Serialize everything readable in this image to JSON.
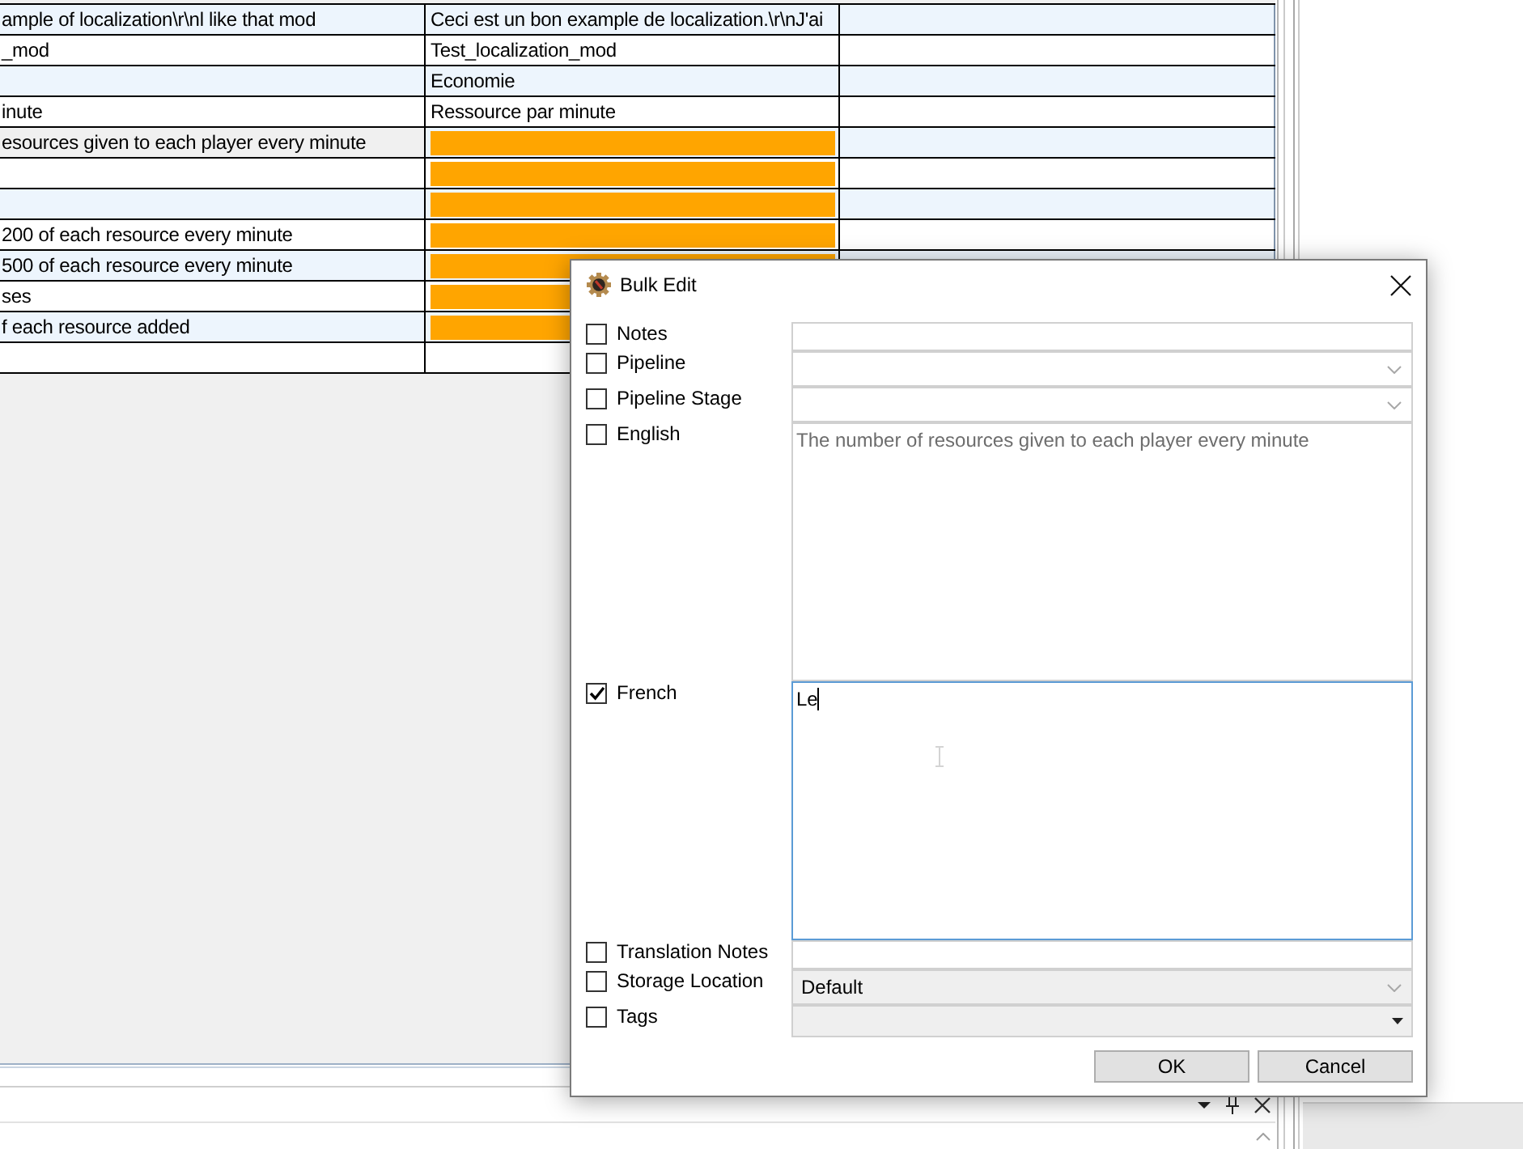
{
  "table": {
    "rows": [
      {
        "column_1": "ample of localization\\r\\nl like that mod",
        "column_2": "Ceci est un bon example de localization.\\r\\nJ'ai",
        "selected": false,
        "highlighted": false
      },
      {
        "column_1": "_mod",
        "column_2": "Test_localization_mod",
        "selected": false,
        "highlighted": false
      },
      {
        "column_2": "Economie",
        "selected": false,
        "highlighted": false
      },
      {
        "column_1": "inute",
        "column_2": "Ressource par minute",
        "selected": false,
        "highlighted": false
      },
      {
        "column_1": "esources given to each player every minute",
        "selected": true,
        "highlighted": true
      },
      {
        "selected": false,
        "highlighted": true
      },
      {
        "selected": false,
        "highlighted": true
      },
      {
        "column_1": "200 of each resource every minute",
        "selected": false,
        "highlighted": true
      },
      {
        "column_1": "500 of each resource every minute",
        "selected": false,
        "highlighted": true
      },
      {
        "column_1": "ses",
        "selected": false,
        "highlighted": true
      },
      {
        "column_1": "f each resource added",
        "selected": false,
        "highlighted": true
      },
      {
        "selected": false,
        "highlighted": false
      }
    ]
  },
  "dialog": {
    "title": "Bulk Edit",
    "fields": [
      {
        "label": "Notes",
        "kind": "text",
        "checked": false,
        "focused": false
      },
      {
        "label": "Pipeline",
        "kind": "combo",
        "checked": false,
        "focused": false
      },
      {
        "label": "Pipeline Stage",
        "kind": "combo",
        "checked": false,
        "focused": false
      },
      {
        "label": "English",
        "kind": "textarea",
        "checked": false,
        "focused": false,
        "value": "The number of resources given to each player every minute"
      },
      {
        "label": "French",
        "kind": "textarea",
        "checked": true,
        "focused": true,
        "value": "Le"
      },
      {
        "label": "Translation Notes",
        "kind": "text",
        "checked": false,
        "focused": false
      },
      {
        "label": "Storage Location",
        "kind": "list",
        "checked": false,
        "focused": false,
        "value": "Default"
      },
      {
        "label": "Tags",
        "kind": "tags",
        "checked": false,
        "focused": false
      }
    ],
    "buttons": [
      "OK",
      "Cancel"
    ]
  }
}
